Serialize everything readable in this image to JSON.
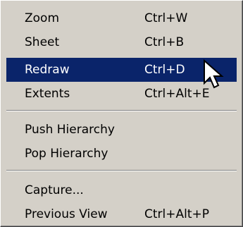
{
  "menu": {
    "groups": [
      {
        "items": [
          {
            "label": "Zoom",
            "shortcut": "Ctrl+W",
            "highlighted": false
          },
          {
            "label": "Sheet",
            "shortcut": "Ctrl+B",
            "highlighted": false
          },
          {
            "label": "Redraw",
            "shortcut": "Ctrl+D",
            "highlighted": true
          },
          {
            "label": "Extents",
            "shortcut": "Ctrl+Alt+E",
            "highlighted": false
          }
        ]
      },
      {
        "items": [
          {
            "label": "Push Hierarchy",
            "shortcut": "",
            "highlighted": false
          },
          {
            "label": "Pop Hierarchy",
            "shortcut": "",
            "highlighted": false
          }
        ]
      },
      {
        "items": [
          {
            "label": "Capture...",
            "shortcut": "",
            "highlighted": false
          },
          {
            "label": "Previous View",
            "shortcut": "Ctrl+Alt+P",
            "highlighted": false
          }
        ]
      }
    ]
  },
  "colors": {
    "menu_background": "#d4d0c8",
    "highlight_background": "#0a246a",
    "highlight_text": "#ffffff"
  },
  "cursor": {
    "icon": "arrow-pointer-icon"
  }
}
